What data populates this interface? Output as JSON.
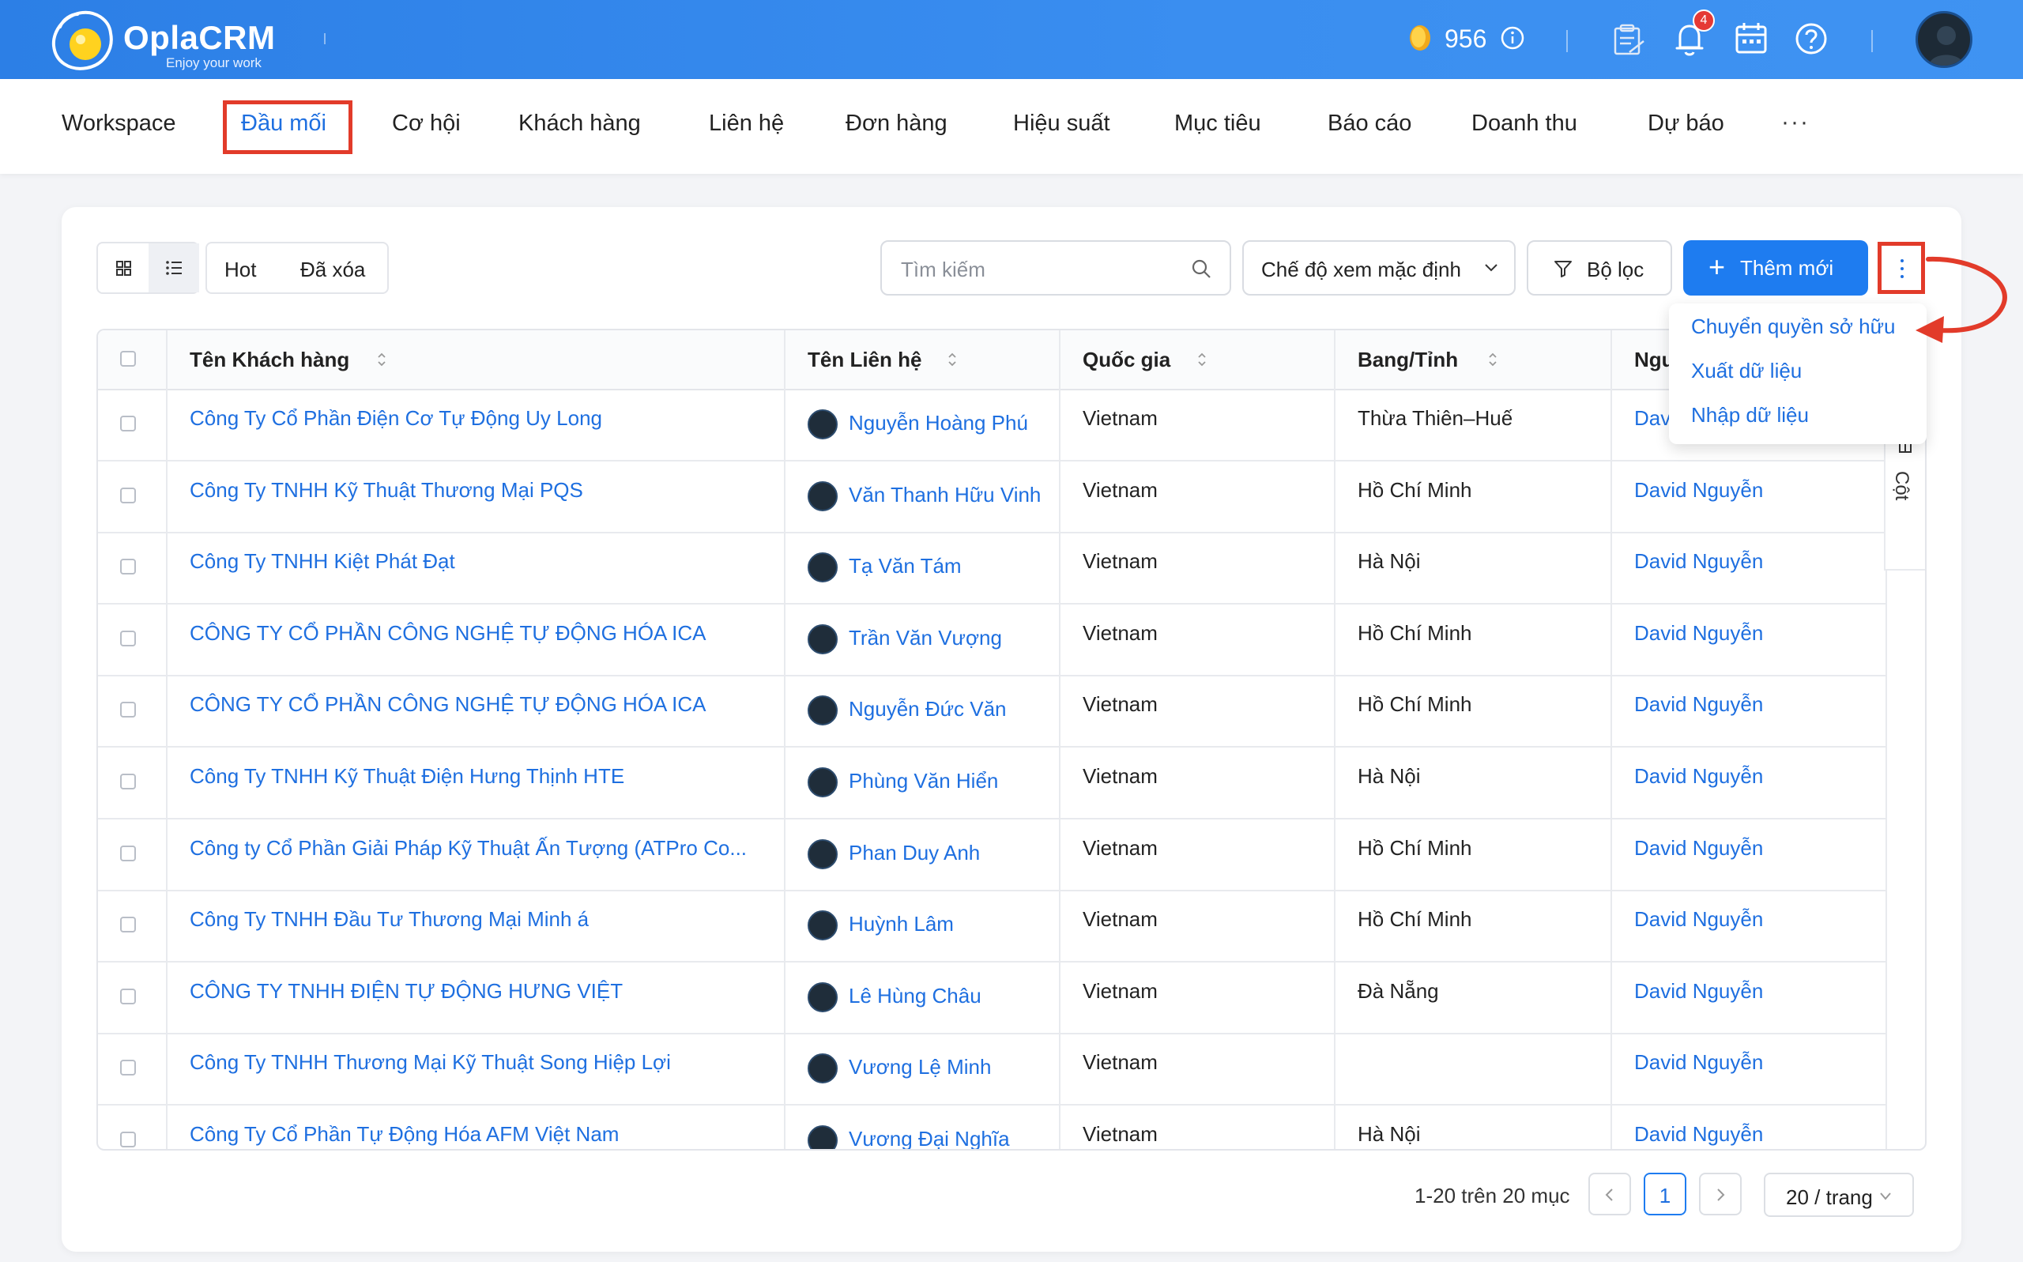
{
  "header": {
    "brand": "OplaCRM",
    "tagline": "Enjoy your work",
    "points": "956",
    "notification_count": "4",
    "icons": [
      "coin-icon",
      "info-icon",
      "tasks-icon",
      "bell-icon",
      "calendar-icon",
      "help-icon",
      "avatar"
    ]
  },
  "nav": {
    "items": [
      "Workspace",
      "Đầu mối",
      "Cơ hội",
      "Khách hàng",
      "Liên hệ",
      "Đơn hàng",
      "Hiệu suất",
      "Mục tiêu",
      "Báo cáo",
      "Doanh thu",
      "Dự báo"
    ],
    "active": "Đầu mối",
    "more": "···"
  },
  "toolbar": {
    "chips": [
      "Hot",
      "Đã xóa"
    ],
    "search_placeholder": "Tìm kiếm",
    "view_mode": "Chế độ xem mặc định",
    "filter_label": "Bộ lọc",
    "add_label": "Thêm mới"
  },
  "dropdown": {
    "items": [
      "Chuyển quyền sở hữu",
      "Xuất dữ liệu",
      "Nhập dữ liệu"
    ]
  },
  "table": {
    "columns": [
      "Tên Khách hàng",
      "Tên Liên hệ",
      "Quốc gia",
      "Bang/Tỉnh",
      "Ngu"
    ],
    "column_panel_label": "Cột",
    "rows": [
      {
        "customer": "Công Ty Cổ Phần Điện Cơ Tự Động Uy Long",
        "contact": "Nguyễn Hoàng Phú",
        "country": "Vietnam",
        "state": "Thừa Thiên–Huế",
        "owner": "Dav"
      },
      {
        "customer": "Công Ty TNHH Kỹ Thuật Thương Mại PQS",
        "contact": "Văn Thanh Hữu Vinh",
        "country": "Vietnam",
        "state": "Hồ Chí Minh",
        "owner": "David Nguyễn"
      },
      {
        "customer": "Công Ty TNHH Kiệt Phát Đạt",
        "contact": "Tạ Văn Tám",
        "country": "Vietnam",
        "state": "Hà Nội",
        "owner": "David Nguyễn"
      },
      {
        "customer": "CÔNG TY CỔ PHẦN CÔNG NGHỆ TỰ ĐỘNG HÓA ICA",
        "contact": "Trần Văn Vượng",
        "country": "Vietnam",
        "state": "Hồ Chí Minh",
        "owner": "David Nguyễn"
      },
      {
        "customer": "CÔNG TY CỔ PHẦN CÔNG NGHỆ TỰ ĐỘNG HÓA ICA",
        "contact": "Nguyễn Đức Văn",
        "country": "Vietnam",
        "state": "Hồ Chí Minh",
        "owner": "David Nguyễn"
      },
      {
        "customer": "Công Ty TNHH Kỹ Thuật Điện Hưng Thịnh HTE",
        "contact": "Phùng Văn Hiển",
        "country": "Vietnam",
        "state": "Hà Nội",
        "owner": "David Nguyễn"
      },
      {
        "customer": "Công ty Cổ Phần Giải Pháp Kỹ Thuật Ấn Tượng (ATPro Co...",
        "contact": "Phan Duy Anh",
        "country": "Vietnam",
        "state": "Hồ Chí Minh",
        "owner": "David Nguyễn"
      },
      {
        "customer": "Công Ty TNHH Đầu Tư Thương Mại Minh á",
        "contact": "Huỳnh Lâm",
        "country": "Vietnam",
        "state": "Hồ Chí Minh",
        "owner": "David Nguyễn"
      },
      {
        "customer": "CÔNG TY TNHH ĐIỆN TỰ ĐỘNG HƯNG VIỆT",
        "contact": "Lê Hùng Châu",
        "country": "Vietnam",
        "state": "Đà Nẵng",
        "owner": "David Nguyễn"
      },
      {
        "customer": "Công Ty TNHH Thương Mại Kỹ Thuật Song Hiệp Lợi",
        "contact": "Vương Lệ Minh",
        "country": "Vietnam",
        "state": "",
        "owner": "David Nguyễn"
      },
      {
        "customer": "Công Ty Cổ Phần Tự Động Hóa AFM Việt Nam",
        "contact": "Vương Đại Nghĩa",
        "country": "Vietnam",
        "state": "Hà Nội",
        "owner": "David Nguyễn"
      }
    ]
  },
  "pagination": {
    "summary": "1-20 trên 20 mục",
    "current_page": "1",
    "page_size": "20 / trang"
  },
  "colors": {
    "header_blue": "#2c7fe6",
    "link_blue": "#1e6fe0",
    "primary_button": "#1e7cf0",
    "annotation_red": "#e23b2a"
  }
}
